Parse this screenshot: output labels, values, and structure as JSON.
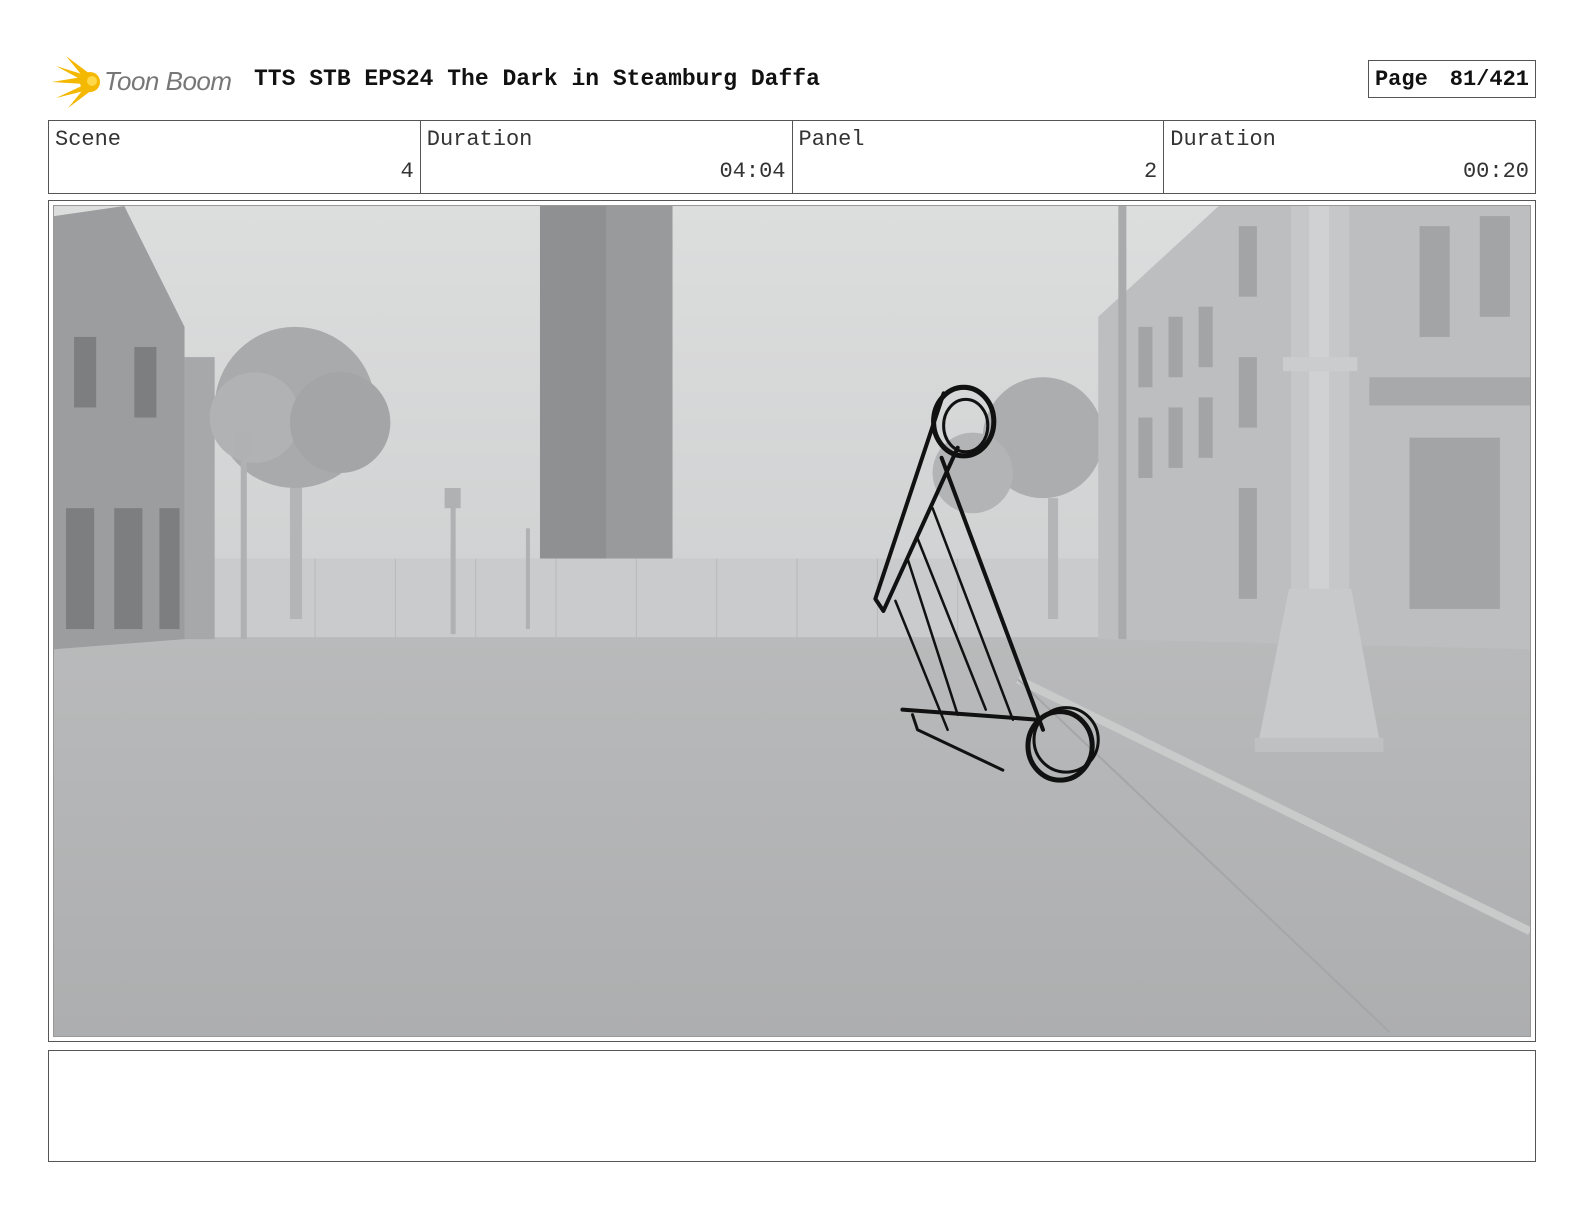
{
  "header": {
    "logo_text": "Toon Boom",
    "title": "TTS STB EPS24 The Dark in Steamburg Daffa",
    "page_label": "Page",
    "page_number": "81/421"
  },
  "info": {
    "scene_label": "Scene",
    "scene_value": "4",
    "scene_duration_label": "Duration",
    "scene_duration_value": "04:04",
    "panel_label": "Panel",
    "panel_value": "2",
    "panel_duration_label": "Duration",
    "panel_duration_value": "00:20"
  },
  "colors": {
    "logo_accent": "#f5b800",
    "sketch": "#111111",
    "sky": "#d6d7d8",
    "ground": "#b3b4b5"
  },
  "notes": ""
}
